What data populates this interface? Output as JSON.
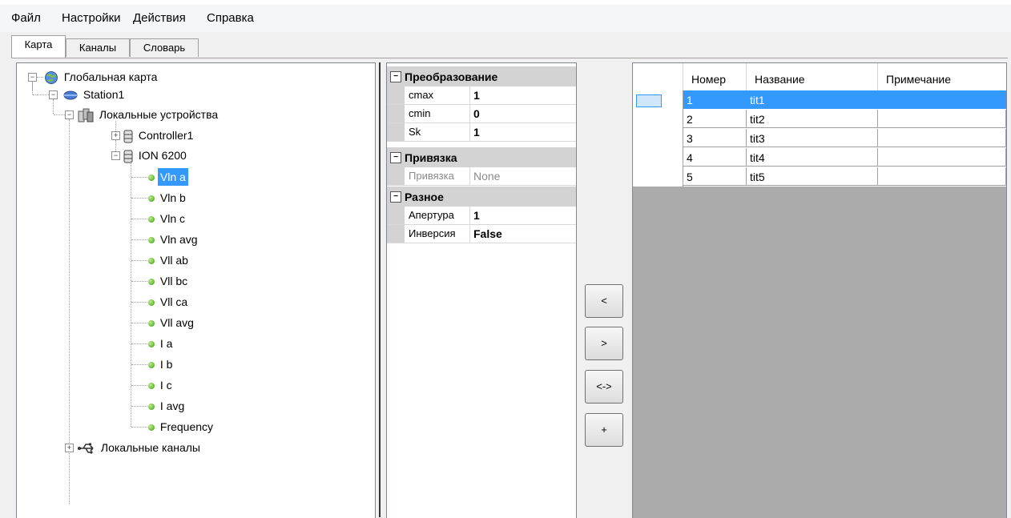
{
  "menu": [
    "Файл",
    "Настройки",
    "Действия",
    "Справка"
  ],
  "tabs": [
    "Карта",
    "Каналы",
    "Словарь"
  ],
  "tree": {
    "root": "Глобальная карта",
    "station": "Station1",
    "local_devices": "Локальные устройства",
    "controller": "Controller1",
    "device": "ION 6200",
    "channels": [
      "Vln a",
      "Vln b",
      "Vln c",
      "Vln avg",
      "Vll ab",
      "Vll bc",
      "Vll ca",
      "Vll avg",
      "I a",
      "I b",
      "I c",
      "I avg",
      "Frequency"
    ],
    "selected_channel": "Vln a",
    "local_channels": "Локальные каналы"
  },
  "properties": {
    "categories": [
      {
        "name": "Преобразование",
        "rows": [
          {
            "name": "cmax",
            "value": "1"
          },
          {
            "name": "cmin",
            "value": "0"
          },
          {
            "name": "Sk",
            "value": "1"
          }
        ]
      },
      {
        "name": "Привязка",
        "rows": [
          {
            "name": "Привязка",
            "value": "None"
          }
        ]
      },
      {
        "name": "Разное",
        "rows": [
          {
            "name": "Апертура",
            "value": "1"
          },
          {
            "name": "Инверсия",
            "value": "False"
          }
        ]
      }
    ]
  },
  "buttons": [
    "<",
    ">",
    "<->",
    "+"
  ],
  "grid": {
    "columns": [
      "Номер",
      "Название",
      "Примечание"
    ],
    "rows": [
      {
        "num": "1",
        "name": "tit1",
        "note": ""
      },
      {
        "num": "2",
        "name": "tit2",
        "note": ""
      },
      {
        "num": "3",
        "name": "tit3",
        "note": ""
      },
      {
        "num": "4",
        "name": "tit4",
        "note": ""
      },
      {
        "num": "5",
        "name": "tit5",
        "note": ""
      }
    ],
    "selected_row": "1"
  },
  "colors": {
    "selection": "#3399ff",
    "grid_bg": "#ababab",
    "category_bg": "#d3d3d3"
  },
  "icons": [
    "globe-icon",
    "network-icon",
    "devices-icon",
    "database-icon",
    "green-dot-icon",
    "usb-icon"
  ]
}
